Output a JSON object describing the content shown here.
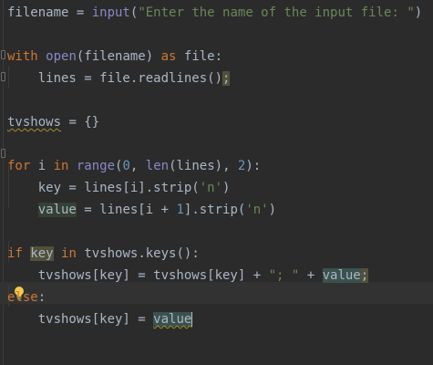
{
  "editor": {
    "lines": [
      {
        "segments": [
          {
            "t": "filename = ",
            "c": ""
          },
          {
            "t": "input",
            "c": "bi"
          },
          {
            "t": "(",
            "c": ""
          },
          {
            "t": "\"Enter the name of the input file: \"",
            "c": "str"
          },
          {
            "t": ")",
            "c": ""
          }
        ]
      },
      {
        "segments": []
      },
      {
        "segments": [
          {
            "t": "with ",
            "c": "kw"
          },
          {
            "t": "open",
            "c": "bi"
          },
          {
            "t": "(filename) ",
            "c": ""
          },
          {
            "t": "as ",
            "c": "kw"
          },
          {
            "t": "file:",
            "c": ""
          }
        ]
      },
      {
        "segments": [
          {
            "t": "    lines = file.readlines()",
            "c": ""
          },
          {
            "t": ";",
            "c": "hl3"
          }
        ]
      },
      {
        "segments": []
      },
      {
        "segments": [
          {
            "t": "tvshows",
            "c": "warn-underline"
          },
          {
            "t": " = {}",
            "c": ""
          }
        ]
      },
      {
        "segments": []
      },
      {
        "segments": [
          {
            "t": "for ",
            "c": "kw"
          },
          {
            "t": "i ",
            "c": ""
          },
          {
            "t": "in ",
            "c": "kw"
          },
          {
            "t": "range",
            "c": "bi"
          },
          {
            "t": "(",
            "c": ""
          },
          {
            "t": "0",
            "c": "num"
          },
          {
            "t": ", ",
            "c": ""
          },
          {
            "t": "len",
            "c": "bi"
          },
          {
            "t": "(lines), ",
            "c": ""
          },
          {
            "t": "2",
            "c": "num"
          },
          {
            "t": "):",
            "c": ""
          }
        ]
      },
      {
        "segments": [
          {
            "t": "    key = lines[i].strip(",
            "c": ""
          },
          {
            "t": "'n'",
            "c": "str"
          },
          {
            "t": ")",
            "c": ""
          }
        ]
      },
      {
        "segments": [
          {
            "t": "    ",
            "c": ""
          },
          {
            "t": "value",
            "c": "hl"
          },
          {
            "t": " = lines[i + ",
            "c": ""
          },
          {
            "t": "1",
            "c": "num"
          },
          {
            "t": "].strip(",
            "c": ""
          },
          {
            "t": "'n'",
            "c": "str"
          },
          {
            "t": ")",
            "c": ""
          }
        ]
      },
      {
        "segments": []
      },
      {
        "segments": [
          {
            "t": "if ",
            "c": "kw"
          },
          {
            "t": "key",
            "c": "hl3"
          },
          {
            "t": " ",
            "c": ""
          },
          {
            "t": "in ",
            "c": "kw"
          },
          {
            "t": "tvshows.keys():",
            "c": ""
          }
        ]
      },
      {
        "segments": [
          {
            "t": "    tvshows[key] = tvshows[key] + ",
            "c": ""
          },
          {
            "t": "\"; \"",
            "c": "str"
          },
          {
            "t": " + ",
            "c": ""
          },
          {
            "t": "value",
            "c": "hl2"
          },
          {
            "t": ";",
            "c": "hl3"
          }
        ]
      },
      {
        "segments": [
          {
            "t": "else",
            "c": "kw"
          },
          {
            "t": ":",
            "c": ""
          }
        ]
      },
      {
        "segments": [
          {
            "t": "    tvshows[key] = ",
            "c": ""
          },
          {
            "t": "value",
            "c": "hl2 warn-underline"
          }
        ]
      }
    ]
  },
  "colors": {
    "background": "#2b2b2b",
    "keyword": "#cc7832",
    "builtin": "#8888c6",
    "string": "#6a8759",
    "number": "#6897bb",
    "text": "#a9b7c6"
  },
  "icons": {
    "bulb": "intention-bulb-icon",
    "fold": "fold-marker-icon"
  }
}
